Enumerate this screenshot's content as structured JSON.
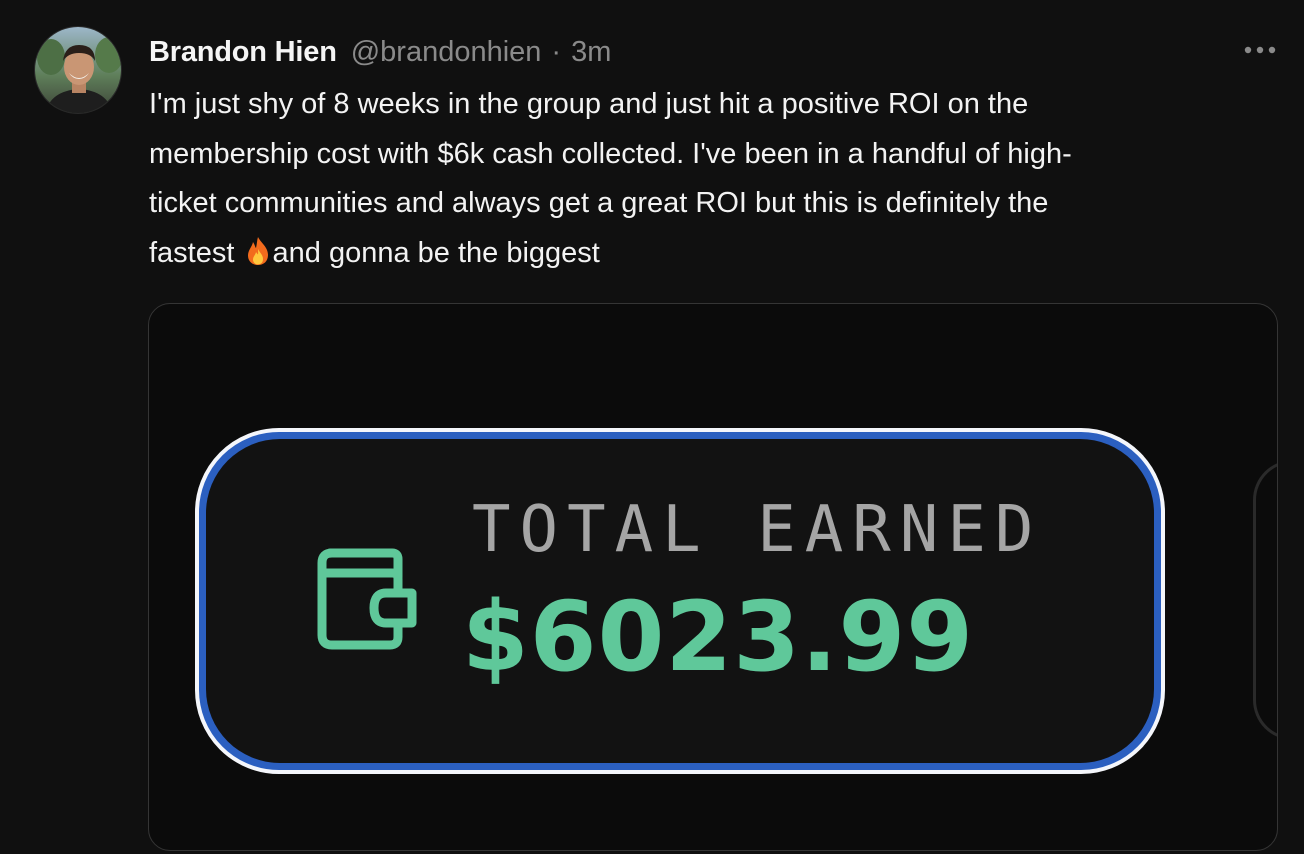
{
  "post": {
    "author_name": "Brandon Hien",
    "handle": "@brandonhien",
    "separator": "·",
    "timestamp": "3m",
    "more_icon": "more-horizontal-icon",
    "text_before_emoji": "I'm just shy of 8 weeks in the group and just hit a positive ROI on the\nmembership cost with $6k cash collected. I've been in a handful of high-\nticket communities and always get a great ROI but this is definitely the\nfastest ",
    "emoji": "🔥",
    "text_after_emoji": "and gonna be the biggest"
  },
  "media": {
    "card_label": "TOTAL EARNED",
    "card_amount": "$6023.99",
    "card_icon": "wallet-icon",
    "colors": {
      "accent_green": "#5fc89a",
      "border_blue": "#2b5fc0",
      "label_gray": "#a5a5a5"
    }
  }
}
